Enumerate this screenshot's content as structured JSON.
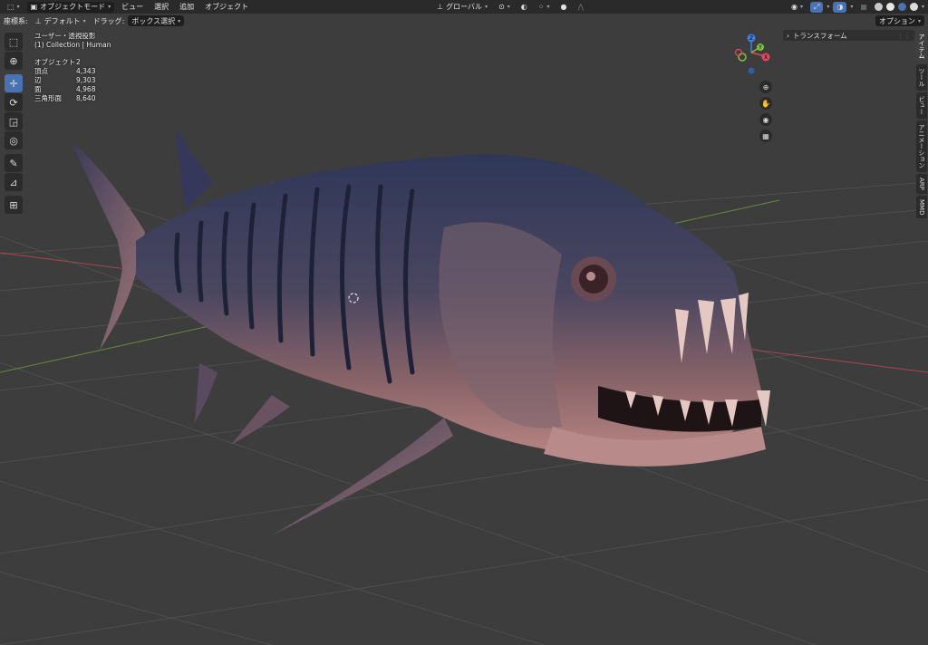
{
  "header": {
    "editor_icon": "viewport-editor-icon",
    "mode": "オブジェクトモード",
    "menus": [
      "ビュー",
      "選択",
      "追加",
      "オブジェクト"
    ],
    "orientation": "グローバル"
  },
  "subheader": {
    "coord_label": "座標系:",
    "coord_value": "デフォルト",
    "drag_label": "ドラッグ:",
    "drag_value": "ボックス選択",
    "options": "オプション"
  },
  "overlay": {
    "view_name": "ユーザー・透視投影",
    "collection": "(1) Collection | Human",
    "stats": [
      {
        "label": "オブジェクト",
        "value": "2"
      },
      {
        "label": "頂点",
        "value": "4,343"
      },
      {
        "label": "辺",
        "value": "9,303"
      },
      {
        "label": "面",
        "value": "4,968"
      },
      {
        "label": "三角形面",
        "value": "8,640"
      }
    ]
  },
  "gizmo": {
    "x": "X",
    "y": "Y",
    "z": "Z"
  },
  "npanel": {
    "transform": "トランスフォーム"
  },
  "side_tabs": [
    "アイテム",
    "ツール",
    "ビュー",
    "アニメーション",
    "ARP",
    "MMD"
  ],
  "colors": {
    "accent": "#4772b3",
    "header": "#2a2a2a",
    "viewport": "#3d3d3d",
    "x_axis": "#e04b5a",
    "y_axis": "#7fc140",
    "z_axis": "#3f7fe0"
  }
}
